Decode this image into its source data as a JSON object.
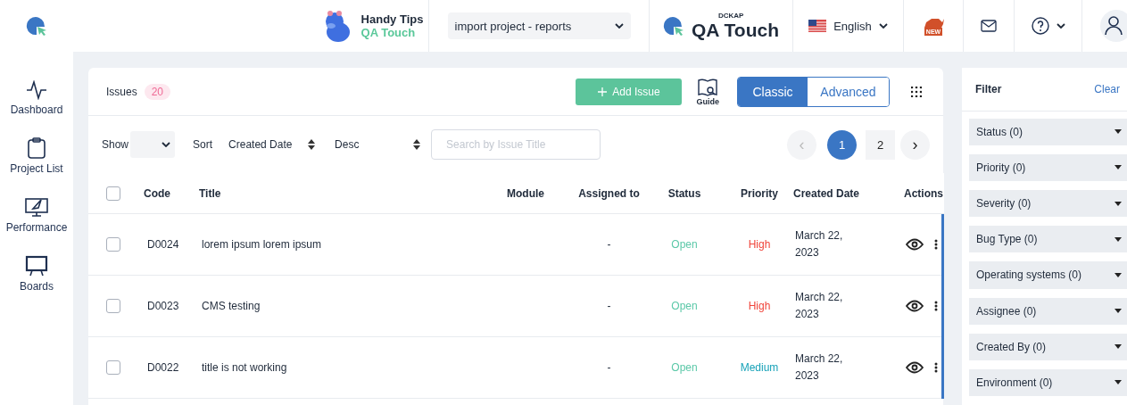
{
  "header": {
    "tips_title": "Handy Tips",
    "tips_subtitle": "QA Touch",
    "project_select": "import project - reports",
    "brand_small": "DCKAP",
    "brand": "QA Touch",
    "language": "English",
    "new_badge": "NEW"
  },
  "sidebar": {
    "items": [
      {
        "label": "Dashboard",
        "kind": "pulse"
      },
      {
        "label": "Project List",
        "kind": "clipboard"
      },
      {
        "label": "Performance",
        "kind": "rocket"
      },
      {
        "label": "Boards",
        "kind": "board"
      }
    ]
  },
  "toolbar": {
    "title": "Issues",
    "count": "20",
    "add_button": "Add Issue",
    "guide": "Guide",
    "views": [
      {
        "label": "Classic",
        "selected": true
      },
      {
        "label": "Advanced",
        "selected": false
      }
    ]
  },
  "controls": {
    "show_label": "Show",
    "sort_label": "Sort",
    "sort_field": "Created Date",
    "sort_order": "Desc",
    "search_placeholder": "Search by Issue Title",
    "pages": [
      {
        "label": "1",
        "selected": true
      },
      {
        "label": "2",
        "selected": false
      }
    ],
    "prev": "‹",
    "next": "›"
  },
  "table": {
    "all_checked": false,
    "columns": [
      "Code",
      "Title",
      "Module",
      "Assigned to",
      "Status",
      "Priority",
      "Created Date",
      "Actions"
    ],
    "rows": [
      {
        "checked": false,
        "code": "D0024",
        "title": "lorem ipsum lorem ipsum",
        "assigned": "-",
        "status": "Open",
        "priority": "High",
        "color": "#f0443a",
        "created": "March 22, 2023"
      },
      {
        "checked": false,
        "code": "D0023",
        "title": "CMS testing",
        "assigned": "-",
        "status": "Open",
        "priority": "High",
        "color": "#f0443a",
        "created": "March 22, 2023"
      },
      {
        "checked": false,
        "code": "D0022",
        "title": "title is not working",
        "assigned": "-",
        "status": "Open",
        "priority": "Medium",
        "color": "#17a2b8",
        "created": "March 22, 2023"
      }
    ]
  },
  "filter": {
    "title": "Filter",
    "clear": "Clear",
    "groups": [
      "Status (0)",
      "Priority (0)",
      "Severity (0)",
      "Bug Type (0)",
      "Operating systems (0)",
      "Assignee (0)",
      "Created By (0)",
      "Environment (0)"
    ]
  }
}
